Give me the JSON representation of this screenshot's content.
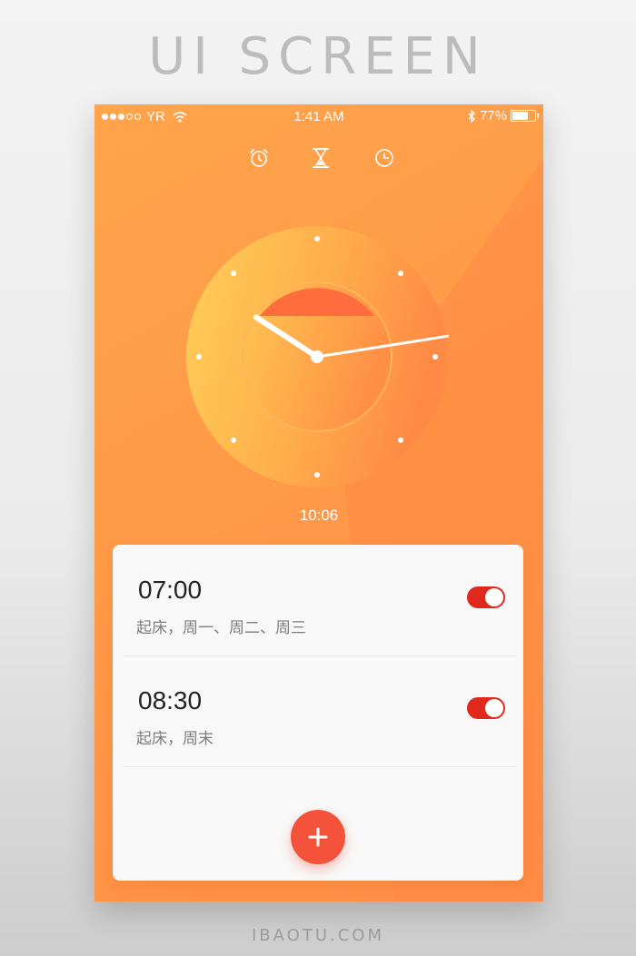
{
  "page_heading": "UI SCREEN",
  "footer_site": "IBAOTU.COM",
  "status_bar": {
    "carrier": "YR",
    "signal_bars_filled": 3,
    "signal_bars_total": 5,
    "time": "1:41 AM",
    "battery_text": "77%",
    "battery_level": 0.77,
    "icons": [
      "wifi-icon",
      "bluetooth-icon",
      "battery-icon"
    ]
  },
  "mode_tabs": [
    {
      "icon": "alarm-clock-icon"
    },
    {
      "icon": "hourglass-icon"
    },
    {
      "icon": "clock-icon"
    }
  ],
  "clock": {
    "display_time": "10:06",
    "hour": 10,
    "minute": 6,
    "accent_colors": {
      "face_light": "#ffcf57",
      "face_dark": "#ff8a45",
      "center_disc": "#ff6c3e"
    }
  },
  "alarms": [
    {
      "time": "07:00",
      "label": "起床，周一、周二、周三",
      "enabled": true
    },
    {
      "time": "08:30",
      "label": "起床，周末",
      "enabled": true
    }
  ],
  "add_button": {
    "icon": "plus-icon"
  },
  "colors": {
    "background": "#ff9a48",
    "toggle_on": "#e0281c",
    "add_button": "#f4523a"
  }
}
